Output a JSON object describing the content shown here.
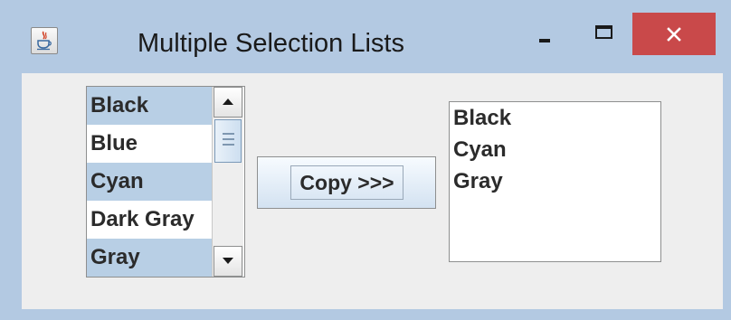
{
  "window": {
    "title": "Multiple Selection Lists",
    "app_icon": "java-cup-icon",
    "controls": {
      "minimize_icon": "minimize-icon",
      "maximize_icon": "maximize-icon",
      "close_icon": "close-icon",
      "close_color": "#c9494a"
    }
  },
  "source_list": {
    "items": [
      {
        "label": "Black",
        "selected": true
      },
      {
        "label": "Blue",
        "selected": false
      },
      {
        "label": "Cyan",
        "selected": true
      },
      {
        "label": "Dark Gray",
        "selected": false
      },
      {
        "label": "Gray",
        "selected": true
      }
    ],
    "selection_color": "#b8cfe5"
  },
  "copy_button": {
    "label": "Copy >>>"
  },
  "target_list": {
    "items": [
      "Black",
      "Cyan",
      "Gray"
    ]
  }
}
